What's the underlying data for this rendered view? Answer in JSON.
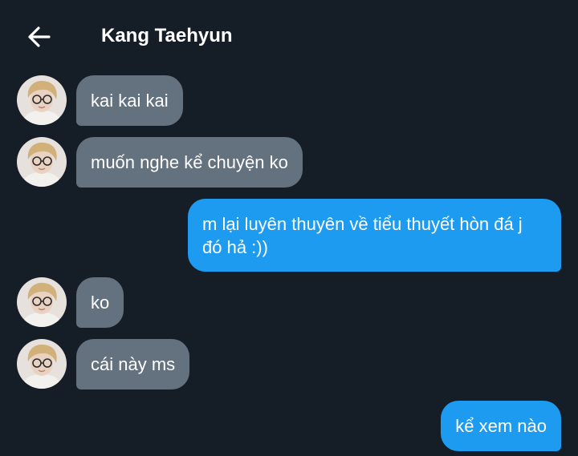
{
  "header": {
    "back_icon": "arrow-left-icon",
    "title": "Kang Taehyun"
  },
  "colors": {
    "background": "#151d27",
    "incoming_bubble": "#64717e",
    "outgoing_bubble": "#1d9bf0"
  },
  "messages": [
    {
      "direction": "incoming",
      "text": "kai kai kai"
    },
    {
      "direction": "incoming",
      "text": "muốn nghe kể chuyện ko"
    },
    {
      "direction": "outgoing",
      "text": "m lại luyên thuyên về tiểu thuyết hòn đá j đó hả :))"
    },
    {
      "direction": "incoming",
      "text": "ko"
    },
    {
      "direction": "incoming",
      "text": "cái này ms"
    },
    {
      "direction": "outgoing",
      "text": "kể xem nào"
    }
  ]
}
